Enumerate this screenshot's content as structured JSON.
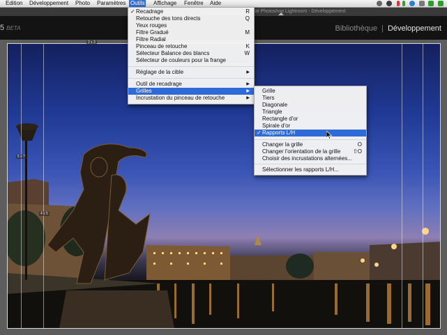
{
  "menubar": {
    "items": [
      "Edition",
      "Développement",
      "Photo",
      "Paramètres",
      "Outils",
      "Affichage",
      "Fenêtre",
      "Aide"
    ],
    "active_index": 4,
    "status_icons": [
      "gear-icon",
      "stop-icon",
      "battery-icon",
      "sync-icon",
      "plugin-icon",
      "wifi-icon",
      "n-icon",
      "bars-icon",
      "n-icon",
      "bluetooth-icon"
    ]
  },
  "window": {
    "title": "obe Photoshop Lightroom - Développement"
  },
  "app": {
    "version": "5",
    "beta": "BETA",
    "modules": [
      "Bibliothèque",
      "|",
      "Développement"
    ]
  },
  "overlay_labels": {
    "top": "2 x 3",
    "left_upper": "5 x 7",
    "left_lower": "4 x 5"
  },
  "tools_menu": {
    "items": [
      {
        "label": "Recadrage",
        "shortcut": "R",
        "checked": true
      },
      {
        "label": "Retouche des tons directs",
        "shortcut": "Q"
      },
      {
        "label": "Yeux rouges",
        "shortcut": ""
      },
      {
        "label": "Filtre Gradué",
        "shortcut": "M"
      },
      {
        "label": "Filtre Radial",
        "shortcut": ""
      },
      {
        "label": "Pinceau de retouche",
        "shortcut": "K"
      },
      {
        "label": "Sélecteur Balance des blancs",
        "shortcut": "W"
      },
      {
        "label": "Sélecteur de couleurs pour la frange",
        "shortcut": ""
      },
      {
        "label": "Réglage de la cible",
        "submenu": true
      },
      {
        "label": "Outil de recadrage",
        "submenu": true
      },
      {
        "label": "Grilles",
        "submenu": true,
        "highlighted": true
      },
      {
        "label": "Incrustation du pinceau de retouche",
        "submenu": true
      }
    ]
  },
  "grids_menu": {
    "items": [
      {
        "label": "Grille"
      },
      {
        "label": "Tiers"
      },
      {
        "label": "Diagonale"
      },
      {
        "label": "Triangle"
      },
      {
        "label": "Rectangle d'or"
      },
      {
        "label": "Spirale d'or"
      },
      {
        "label": "Rapports L/H",
        "checked": true,
        "highlighted": true
      },
      {
        "label": "Changer la grille",
        "shortcut": "O"
      },
      {
        "label": "Changer l'orientation de la grille",
        "shortcut": "⇧O"
      },
      {
        "label": "Choisir des incrustations alternées..."
      },
      {
        "label": "Sélectionner les rapports L/H..."
      }
    ]
  },
  "colors": {
    "menu_highlight": "#2e6bd9",
    "module_active": "#e6e6e6"
  }
}
